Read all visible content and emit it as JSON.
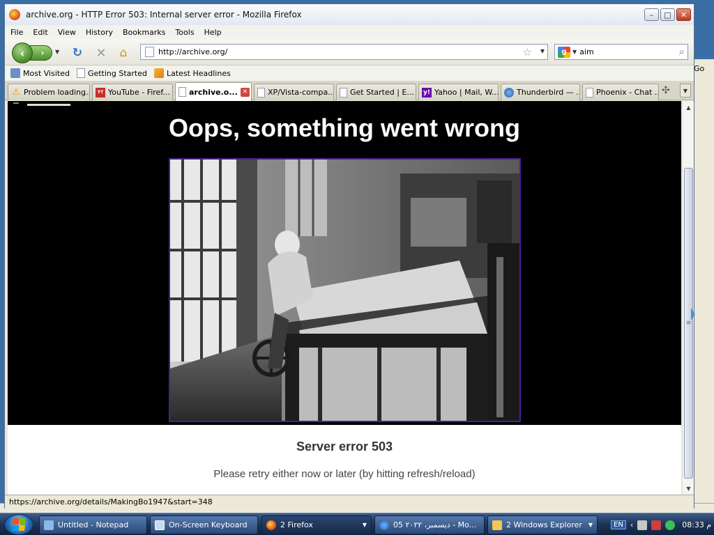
{
  "window": {
    "title": "archive.org - HTTP Error 503: Internal server error - Mozilla Firefox",
    "minimize": "–",
    "maximize": "□",
    "close": "✕"
  },
  "menu": [
    "File",
    "Edit",
    "View",
    "History",
    "Bookmarks",
    "Tools",
    "Help"
  ],
  "navbar": {
    "back": "‹",
    "forward": "›",
    "url": "http://archive.org/",
    "search_text": "aim",
    "search_engine_icon": "google-icon"
  },
  "bookmarks": [
    "Most Visited",
    "Getting Started",
    "Latest Headlines"
  ],
  "tabs": [
    {
      "label": "Problem loading...",
      "icon": "warning-icon"
    },
    {
      "label": "YouTube - Firef...",
      "icon": "youtube-icon"
    },
    {
      "label": "archive.o...",
      "icon": "page-icon",
      "active": true
    },
    {
      "label": "XP/Vista-compa...",
      "icon": "page-icon"
    },
    {
      "label": "Get Started | E...",
      "icon": "page-icon"
    },
    {
      "label": "Yahoo | Mail, W...",
      "icon": "yahoo-icon"
    },
    {
      "label": "Thunderbird — ...",
      "icon": "thunderbird-icon"
    },
    {
      "label": "Phoenix - Chat ...",
      "icon": "page-icon"
    }
  ],
  "page": {
    "heading": "Oops, something went wrong",
    "error_title": "Server error 503",
    "error_message": "Please retry either now or later (by hitting refresh/reload)"
  },
  "status_bar": "https://archive.org/details/MakingBo1947&start=348",
  "background_window": {
    "go_label": "Go"
  },
  "taskbar": {
    "items": [
      {
        "label": "Untitled - Notepad",
        "icon": "notepad-icon"
      },
      {
        "label": "On-Screen Keyboard",
        "icon": "keyboard-icon"
      },
      {
        "label": "2 Firefox",
        "icon": "firefox-icon",
        "active": true
      },
      {
        "label": "05 ديسمبر، ٢٠٢٢ - Mo...",
        "icon": "ie-icon"
      },
      {
        "label": "2 Windows Explorer",
        "icon": "folder-icon"
      }
    ],
    "language": "EN",
    "clock": "08:33 م"
  },
  "colors": {
    "page_black": "#000000",
    "video_border": "#4b1f8f",
    "tab_close": "#d4463a"
  }
}
